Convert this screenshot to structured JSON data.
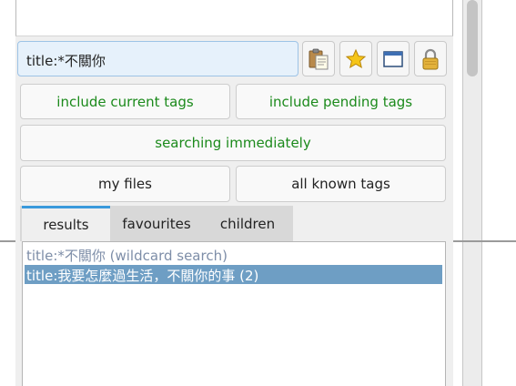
{
  "search": {
    "value": "title:*不關你"
  },
  "icon_buttons": [
    {
      "name": "clipboard-icon"
    },
    {
      "name": "star-icon"
    },
    {
      "name": "window-icon"
    },
    {
      "name": "lock-icon"
    }
  ],
  "buttons": {
    "include_current_tags": "include current tags",
    "include_pending_tags": "include pending tags",
    "searching_immediately": "searching immediately",
    "my_files": "my files",
    "all_known_tags": "all known tags"
  },
  "tabs": [
    {
      "label": "results",
      "active": true
    },
    {
      "label": "favourites",
      "active": false
    },
    {
      "label": "children",
      "active": false
    }
  ],
  "results": [
    {
      "text": "title:*不關你 (wildcard search)",
      "selected": false
    },
    {
      "text": "title:我要怎麼過生活，不關你的事 (2)",
      "selected": true
    }
  ],
  "colors": {
    "accent": "#3a99db",
    "green_text": "#1b8a1b",
    "selection": "#6e9ec4",
    "search_bg": "#e6f1fb"
  }
}
